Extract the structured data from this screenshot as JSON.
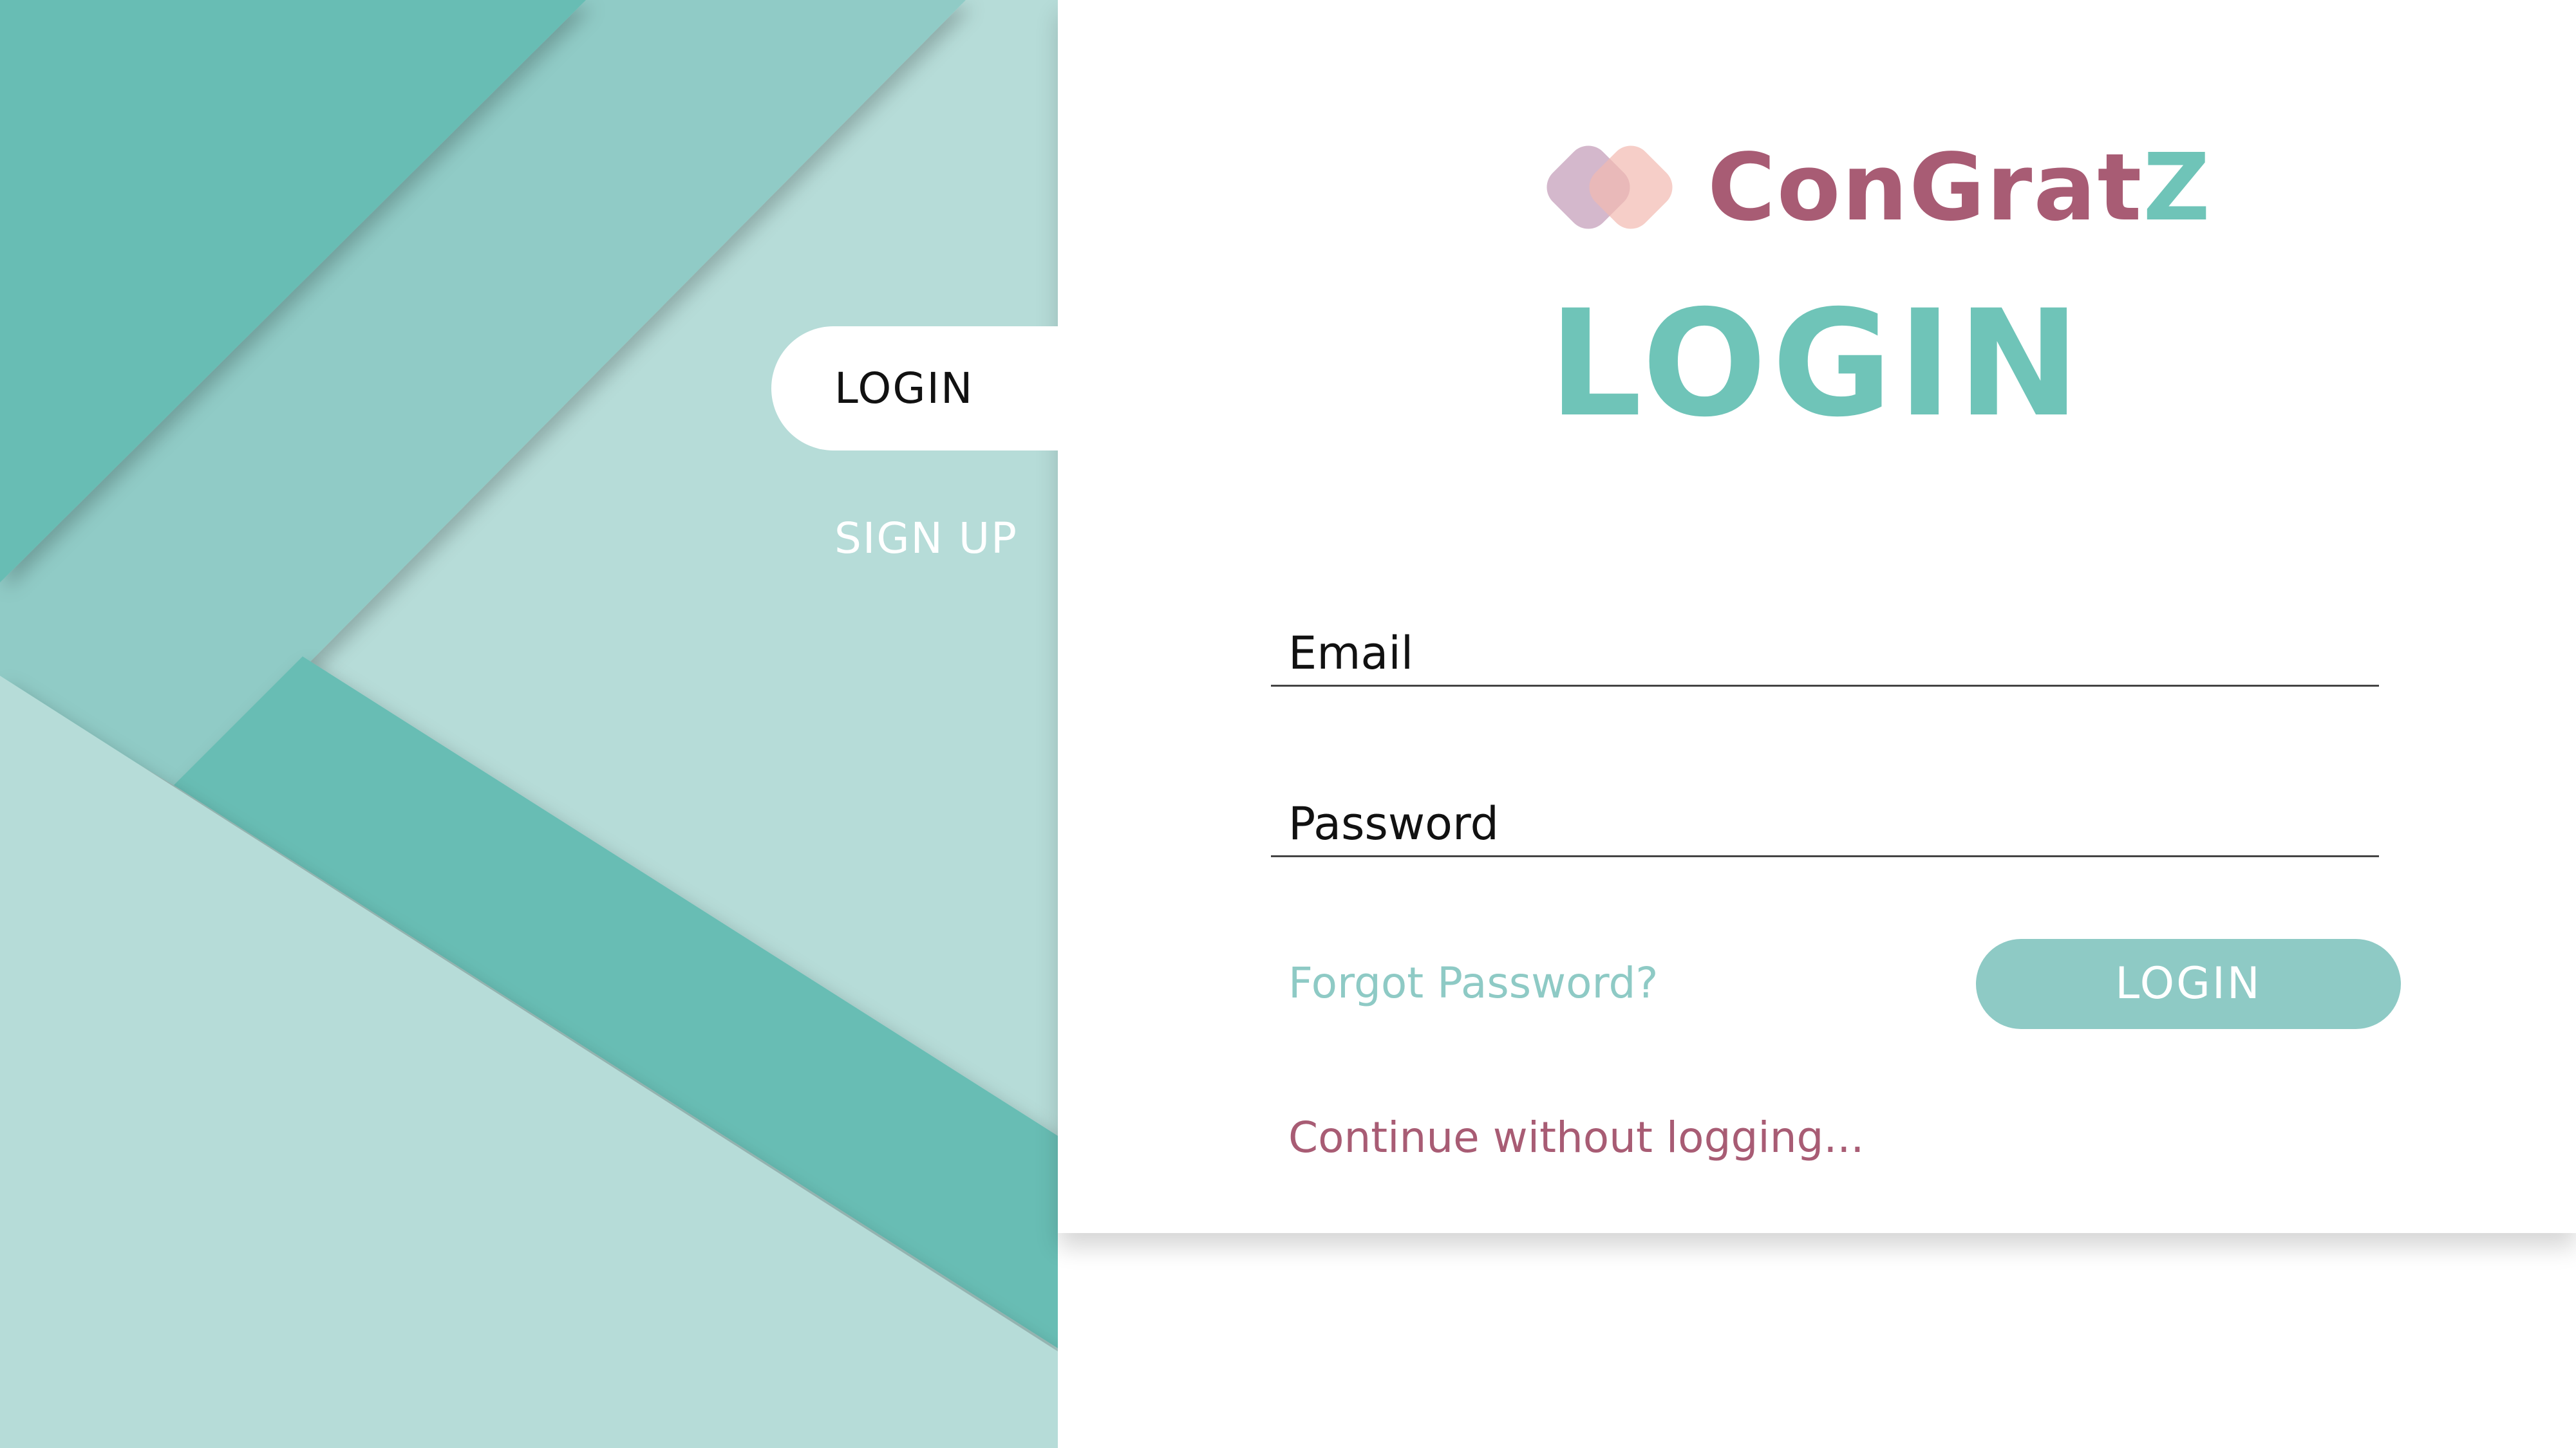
{
  "nav": {
    "login_tab": "LOGIN",
    "signup_tab": "SIGN UP"
  },
  "brand": {
    "name_main": "ConGrat",
    "name_accent": "Z",
    "logo_icon": "overlapping-rounded-squares-icon"
  },
  "form": {
    "title": "LOGIN",
    "email_label": "Email",
    "password_label": "Password",
    "forgot_link": "Forgot Password?",
    "submit_label": "LOGIN",
    "continue_link": "Continue without logging..."
  },
  "colors": {
    "teal_dark": "#67bdb4",
    "teal_mid": "#90cbc6",
    "teal_light": "#b6dcd8",
    "accent_teal": "#6fc4b8",
    "accent_rose": "#a85c74",
    "button_fill": "#8ecac5"
  }
}
